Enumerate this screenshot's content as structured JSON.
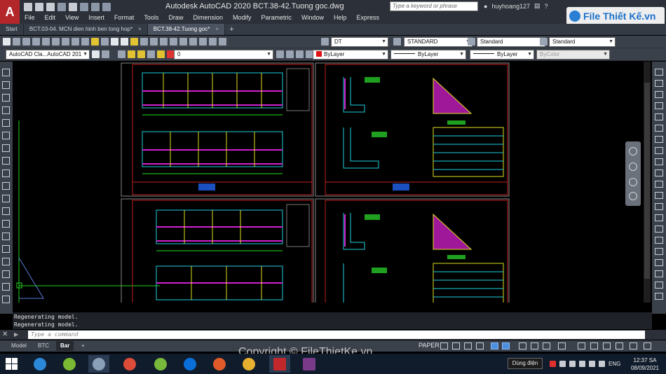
{
  "window": {
    "title": "Autodesk AutoCAD 2020    BCT.38-42.Tuong goc.dwg",
    "app_logo": "A",
    "search_placeholder": "Type a keyword or phrase",
    "user_name": "huyhoang127"
  },
  "menu": [
    "File",
    "Edit",
    "View",
    "Insert",
    "Format",
    "Tools",
    "Draw",
    "Dimension",
    "Modify",
    "Parametric",
    "Window",
    "Help",
    "Express"
  ],
  "watermark": {
    "logo_text": "File Thiết Kế.vn",
    "copyright": "Copyright © FileThietKe.vn"
  },
  "file_tabs": [
    {
      "label": "Start",
      "active": false
    },
    {
      "label": "BCT.03-04. MCN dien hinh ben tong hop*",
      "active": false
    },
    {
      "label": "BCT.38-42.Tuong goc*",
      "active": true
    }
  ],
  "toolbar1": {
    "text_style": "DT",
    "dim_style": "STANDARD",
    "table_style": "Standard",
    "mleader_style": "Standard"
  },
  "toolbar2": {
    "workspace": "AutoCAD Cla...AutoCAD 201",
    "layer": "0",
    "color": "ByLayer",
    "linetype": "ByLayer",
    "lineweight": "ByLayer",
    "plotstyle": "ByColor"
  },
  "command_history": [
    "Regenerating model.",
    "Regenerating model."
  ],
  "command_placeholder": "Type a command",
  "layout_tabs": [
    {
      "label": "Model",
      "active": false
    },
    {
      "label": "BTC",
      "active": false
    },
    {
      "label": "Bar",
      "active": true
    }
  ],
  "status": {
    "space": "PAPER"
  },
  "taskbar": {
    "power_label": "Dùng điện",
    "language": "ENG",
    "time": "12:37 SA",
    "date": "08/09/2021"
  },
  "colors": {
    "accent_red": "#b3262a",
    "drawing_border": "#c02020",
    "rebar_magenta": "#d020d0",
    "dim_green": "#20e020",
    "cad_yellow": "#e0e020",
    "cad_cyan": "#20d0e0"
  },
  "icons": [
    "search-icon",
    "user-icon",
    "cart-icon",
    "help-icon",
    "close-icon",
    "add-tab-icon"
  ]
}
